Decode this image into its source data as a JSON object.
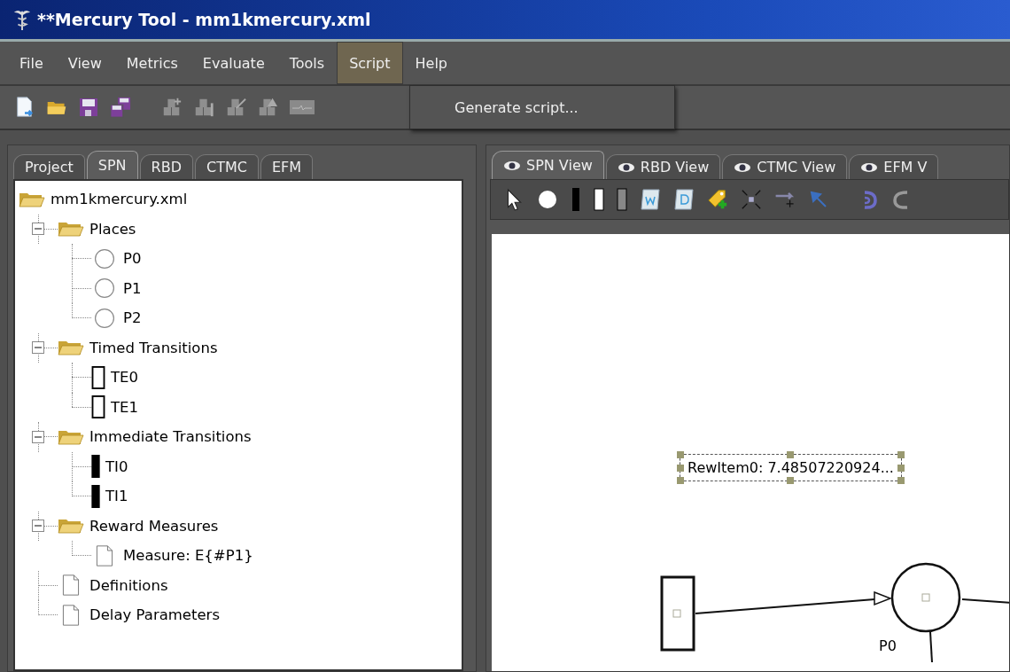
{
  "window": {
    "title": "**Mercury Tool - mm1kmercury.xml"
  },
  "menu": [
    {
      "label": "File",
      "selected": false
    },
    {
      "label": "View",
      "selected": false
    },
    {
      "label": "Metrics",
      "selected": false
    },
    {
      "label": "Evaluate",
      "selected": false
    },
    {
      "label": "Tools",
      "selected": false
    },
    {
      "label": "Script",
      "selected": true
    },
    {
      "label": "Help",
      "selected": false
    }
  ],
  "dropdown": {
    "items": [
      "Generate script..."
    ]
  },
  "toolbar": [
    {
      "kind": "new",
      "disabled": false
    },
    {
      "kind": "open",
      "disabled": false
    },
    {
      "kind": "save",
      "disabled": false
    },
    {
      "kind": "save-all",
      "disabled": false
    },
    {
      "kind": "add-block",
      "disabled": true
    },
    {
      "kind": "remove-block",
      "disabled": true
    },
    {
      "kind": "edit-block",
      "disabled": true
    },
    {
      "kind": "warn-block",
      "disabled": true
    },
    {
      "kind": "monitor",
      "disabled": true
    }
  ],
  "left_tabs": [
    {
      "label": "Project",
      "selected": false
    },
    {
      "label": "SPN",
      "selected": true
    },
    {
      "label": "RBD",
      "selected": false
    },
    {
      "label": "CTMC",
      "selected": false
    },
    {
      "label": "EFM",
      "selected": false
    }
  ],
  "tree": {
    "label": "mm1kmercury.xml",
    "kind": "folder",
    "children": [
      {
        "label": "Places",
        "kind": "folder",
        "expanded": true,
        "children": [
          {
            "label": "P0",
            "kind": "place"
          },
          {
            "label": "P1",
            "kind": "place"
          },
          {
            "label": "P2",
            "kind": "place"
          }
        ]
      },
      {
        "label": "Timed Transitions",
        "kind": "folder",
        "expanded": true,
        "children": [
          {
            "label": "TE0",
            "kind": "timed"
          },
          {
            "label": "TE1",
            "kind": "timed"
          }
        ]
      },
      {
        "label": "Immediate Transitions",
        "kind": "folder",
        "expanded": true,
        "children": [
          {
            "label": "TI0",
            "kind": "immediate"
          },
          {
            "label": "TI1",
            "kind": "immediate"
          }
        ]
      },
      {
        "label": "Reward Measures",
        "kind": "folder",
        "expanded": true,
        "children": [
          {
            "label": "Measure: E{#P1}",
            "kind": "document"
          }
        ]
      },
      {
        "label": "Definitions",
        "kind": "document"
      },
      {
        "label": "Delay Parameters",
        "kind": "document"
      }
    ]
  },
  "view_tabs": [
    {
      "label": "SPN View",
      "selected": true
    },
    {
      "label": "RBD View",
      "selected": false
    },
    {
      "label": "CTMC View",
      "selected": false
    },
    {
      "label": "EFM V",
      "selected": false
    }
  ],
  "canvas": {
    "reward_label": {
      "text": "RewItem0: 7.48507220924...",
      "selected": true
    },
    "place_label": "P0"
  }
}
